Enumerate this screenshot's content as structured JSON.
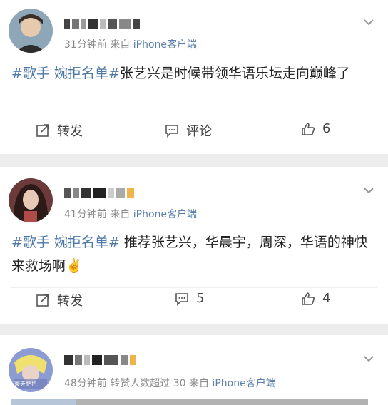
{
  "posts": [
    {
      "time": "31分钟前",
      "from_prefix": "来自",
      "source": "iPhone客户端",
      "tags": [
        "#歌手 婉拒名单#"
      ],
      "text": "张艺兴是时候带领华语乐坛走向巅峰了",
      "repost_label": "转发",
      "comment_label": "评论",
      "like_count": "6"
    },
    {
      "time": "41分钟前",
      "from_prefix": "来自",
      "source": "iPhone客户端",
      "tags": [
        "#歌手 婉拒名单#"
      ],
      "text": " 推荐张艺兴，华晨宇，周深，华语的神快来救场啊✌️",
      "repost_label": "转发",
      "comment_count": "5",
      "like_count": "4"
    },
    {
      "time": "48分钟前",
      "extra": "转赞人数超过 30",
      "from_prefix": "来自",
      "source": "iPhone客户端",
      "avatar_caption": "寰天肥扒"
    }
  ],
  "colors": {
    "link": "#4f79a8",
    "source": "#5b7fa8",
    "meta": "#8a8a8a",
    "bg": "#ededed"
  },
  "icons": [
    "repost-icon",
    "comment-icon",
    "like-icon",
    "chevron-down-icon"
  ]
}
